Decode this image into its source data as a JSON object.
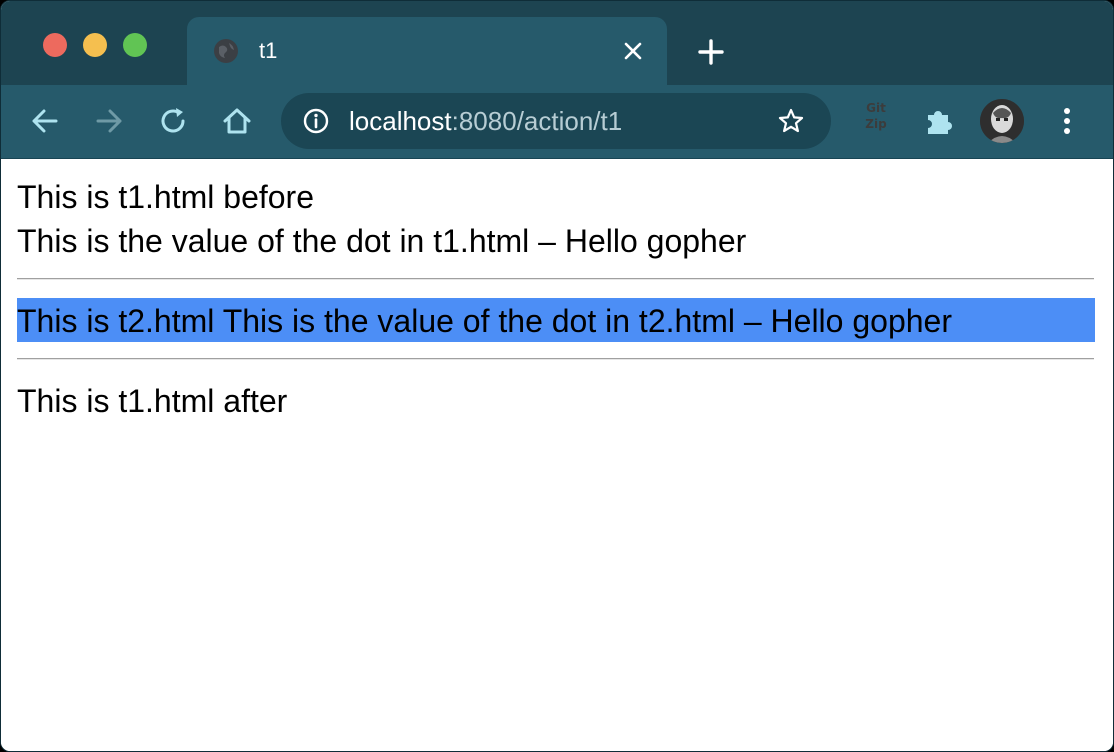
{
  "browser": {
    "tab": {
      "title": "t1"
    },
    "address": {
      "host": "localhost",
      "path": ":8080/action/t1"
    },
    "extensions": {
      "gitzip_line1": "Git",
      "gitzip_line2": "Zip"
    },
    "colors": {
      "frame": "#1d4451",
      "toolbar": "#265a6b",
      "traffic_red": "#ed6a5e",
      "traffic_yellow": "#f5bf4f",
      "traffic_green": "#61c454",
      "selection": "#4c8ef6"
    }
  },
  "page": {
    "line1": "This is t1.html before",
    "line2": "This is the value of the dot in t1.html – Hello gopher",
    "included": "This is t2.html This is the value of the dot in t2.html – Hello gopher",
    "line_after": "This is t1.html after"
  }
}
